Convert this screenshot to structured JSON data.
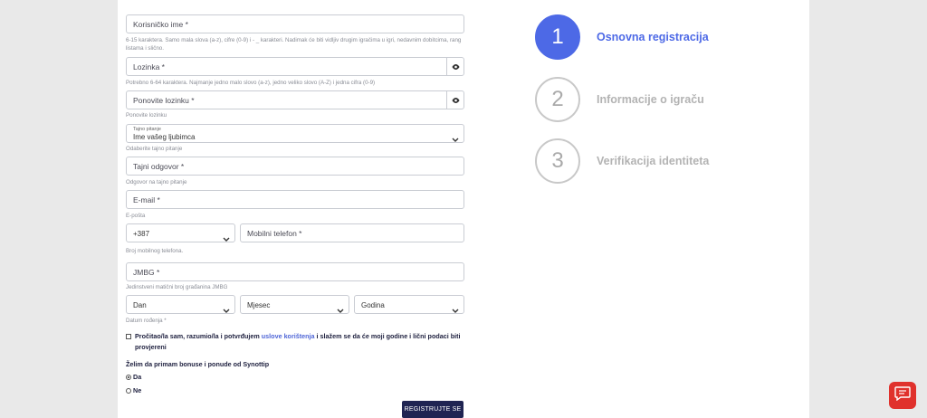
{
  "form": {
    "username": {
      "placeholder": "Korisničko ime *",
      "hint": "6-15 karaktera. Samo mala slova (a-z), cifre (0-9) i - _ karakteri. Nadimak će biti vidljiv drugim igračima u igri, nedavnim dobitcima, rang listama i slično."
    },
    "password": {
      "placeholder": "Lozinka *",
      "hint": "Potrebno 6-64 karaktera. Najmanje jedno malo slovo (a-z), jedno veliko slovo (A-Z) i jedna cifra (0-9)"
    },
    "repeat_password": {
      "placeholder": "Ponovite lozinku *",
      "hint": "Ponovite lozinku"
    },
    "secret_question": {
      "small_label": "Tajno pitanje",
      "value": "Ime vašeg ljubimca",
      "hint": "Odaberite tajno pitanje"
    },
    "secret_answer": {
      "placeholder": "Tajni odgovor *",
      "hint": "Odgovor na tajno pitanje"
    },
    "email": {
      "placeholder": "E-mail *",
      "hint": "E-pošta"
    },
    "phone": {
      "prefix": "+387",
      "placeholder": "Mobilni telefon *",
      "hint": "Broj mobilnog telefona."
    },
    "jmbg": {
      "placeholder": "JMBG *",
      "hint": "Jedinstveni matični broj građanina JMBG"
    },
    "dob": {
      "day": "Dan",
      "month": "Mjesec",
      "year": "Godina",
      "hint": "Datum rođenja *"
    },
    "terms": {
      "before": "Pročitao/la sam, razumio/la i potvrđujem ",
      "link": "uslove korištenja",
      "after": " i slažem se da će moji godine i lični podaci biti provjereni"
    },
    "bonus": {
      "question": "Želim da primam bonuse i ponude od Synottip",
      "yes": "Da",
      "no": "Ne",
      "selected": "Da"
    },
    "submit": "REGISTRUJTE SE"
  },
  "steps": [
    {
      "number": "1",
      "label": "Osnovna registracija",
      "active": true
    },
    {
      "number": "2",
      "label": "Informacije o igraču",
      "active": false
    },
    {
      "number": "3",
      "label": "Verifikacija identiteta",
      "active": false
    }
  ],
  "icons": {
    "password_toggle": "eye-icon",
    "dropdown": "chevron-down-icon",
    "chat": "chat-icon"
  },
  "colors": {
    "accent": "#4d69e6",
    "button": "#1f2452",
    "chat": "#e0312c"
  }
}
